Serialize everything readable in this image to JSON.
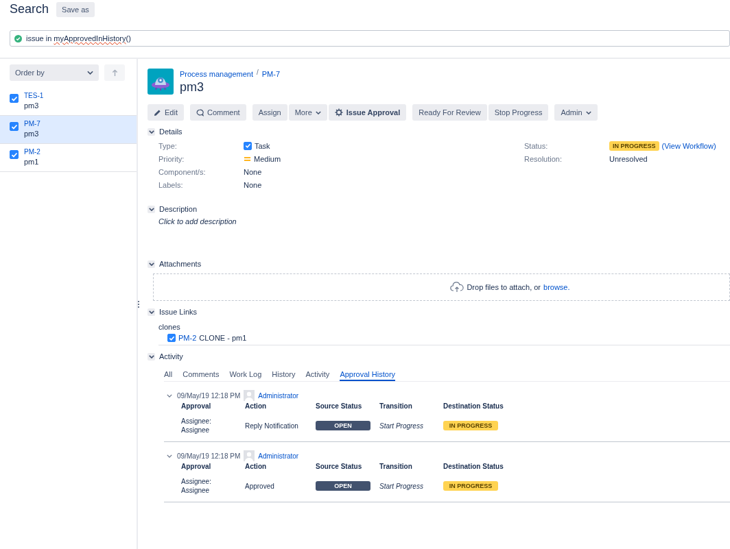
{
  "header": {
    "title": "Search",
    "save_button": "Save as"
  },
  "query": {
    "prefix": "issue in ",
    "function": "myApprovedInHistory",
    "suffix": "()",
    "valid": true
  },
  "sidebar": {
    "order_by": "Order by",
    "items": [
      {
        "key": "TES-1",
        "summary": "pm3",
        "checked": true,
        "selected": false
      },
      {
        "key": "PM-7",
        "summary": "pm3",
        "checked": true,
        "selected": true
      },
      {
        "key": "PM-2",
        "summary": "pm1",
        "checked": true,
        "selected": false
      }
    ]
  },
  "issue": {
    "project": "Process management",
    "separator": "/",
    "key": "PM-7",
    "summary": "pm3",
    "toolbar": [
      {
        "buttons": [
          {
            "label": "Edit",
            "kind": "edit",
            "dropdown": false
          }
        ]
      },
      {
        "buttons": [
          {
            "label": "Comment",
            "kind": "comment",
            "dropdown": false
          }
        ]
      },
      {
        "buttons": [
          {
            "label": "Assign",
            "kind": "plain",
            "dropdown": false
          },
          {
            "label": "More",
            "kind": "plain",
            "dropdown": true
          },
          {
            "label": "Issue Approval",
            "kind": "approval",
            "dropdown": false
          }
        ]
      },
      {
        "buttons": [
          {
            "label": "Ready For Review",
            "kind": "plain",
            "dropdown": false
          },
          {
            "label": "Stop Progress",
            "kind": "plain",
            "dropdown": false
          }
        ]
      },
      {
        "buttons": [
          {
            "label": "Admin",
            "kind": "plain",
            "dropdown": true
          }
        ]
      }
    ],
    "details": {
      "title": "Details",
      "expanded": true,
      "left": [
        {
          "label": "Type:",
          "value": "Task",
          "kind": "type"
        },
        {
          "label": "Priority:",
          "value": "Medium",
          "kind": "priority"
        },
        {
          "label": "Component/s:",
          "value": "None",
          "kind": "text"
        },
        {
          "label": "Labels:",
          "value": "None",
          "kind": "text"
        }
      ],
      "right": [
        {
          "label": "Status:",
          "value": "IN PROGRESS",
          "link": "(View Workflow)",
          "kind": "status"
        },
        {
          "label": "Resolution:",
          "value": "Unresolved",
          "kind": "text"
        }
      ]
    },
    "description": {
      "title": "Description",
      "expanded": true,
      "prompt": "Click to add description"
    },
    "attachments": {
      "title": "Attachments",
      "expanded": true,
      "drop_text": "Drop files to attach, or",
      "browse_link": "browse."
    },
    "issue_links": {
      "title": "Issue Links",
      "expanded": true,
      "link_type": "clones",
      "links": [
        {
          "key": "PM-2",
          "text": "CLONE - pm1",
          "checked": true
        }
      ]
    },
    "activity": {
      "title": "Activity",
      "expanded": true,
      "tabs": [
        {
          "label": "All",
          "selected": false
        },
        {
          "label": "Comments",
          "selected": false
        },
        {
          "label": "Work Log",
          "selected": false
        },
        {
          "label": "History",
          "selected": false
        },
        {
          "label": "Activity",
          "selected": false
        },
        {
          "label": "Approval History",
          "selected": true
        }
      ],
      "entries": [
        {
          "expanded": true,
          "date": "09/May/19 12:18 PM",
          "user": "Administrator",
          "columns": [
            "Approval",
            "Action",
            "Source Status",
            "Transition",
            "Destination Status"
          ],
          "approval": "Assignee: Assignee",
          "action": "Reply Notification",
          "source_status": {
            "label": "OPEN",
            "kind": "todo"
          },
          "transition": "Start Progress",
          "destination_status": {
            "label": "IN PROGRESS",
            "kind": "progress"
          }
        },
        {
          "expanded": true,
          "date": "09/May/19 12:18 PM",
          "user": "Administrator",
          "columns": [
            "Approval",
            "Action",
            "Source Status",
            "Transition",
            "Destination Status"
          ],
          "approval": "Assignee: Assignee",
          "action": "Approved",
          "source_status": {
            "label": "OPEN",
            "kind": "todo"
          },
          "transition": "Start Progress",
          "destination_status": {
            "label": "IN PROGRESS",
            "kind": "progress"
          }
        }
      ]
    }
  }
}
